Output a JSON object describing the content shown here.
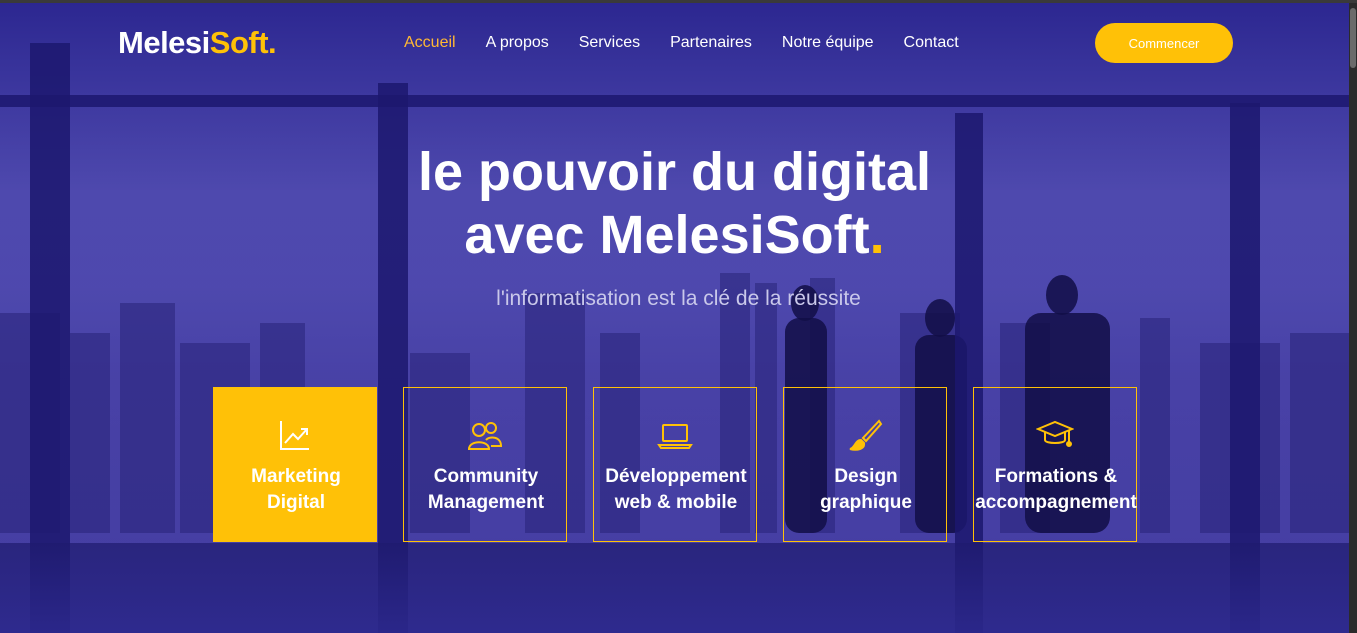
{
  "brand": {
    "name_main": "Melesi",
    "name_accent": "Soft",
    "dot": "."
  },
  "nav": {
    "items": [
      {
        "label": "Accueil",
        "active": true
      },
      {
        "label": "A propos",
        "active": false
      },
      {
        "label": "Services",
        "active": false
      },
      {
        "label": "Partenaires",
        "active": false
      },
      {
        "label": "Notre équipe",
        "active": false
      },
      {
        "label": "Contact",
        "active": false
      }
    ]
  },
  "cta": {
    "label": "Commencer"
  },
  "hero": {
    "line1": "le pouvoir du digital",
    "line2": "avec MelesiSoft",
    "dot": ".",
    "subtitle": "l'informatisation est la clé de la réussite"
  },
  "services": [
    {
      "line1": "Marketing",
      "line2": "Digital",
      "icon": "chart-line-icon",
      "highlighted": true
    },
    {
      "line1": "Community",
      "line2": "Management",
      "icon": "users-icon",
      "highlighted": false
    },
    {
      "line1": "Développement",
      "line2": "web & mobile",
      "icon": "laptop-icon",
      "highlighted": false
    },
    {
      "line1": "Design",
      "line2": "graphique",
      "icon": "paint-brush-icon",
      "highlighted": false
    },
    {
      "line1": "Formations &",
      "line2": "accompagnement",
      "icon": "graduation-cap-icon",
      "highlighted": false
    }
  ],
  "colors": {
    "accent": "#ffc107",
    "overlay": "#2a2a9a",
    "nav_active": "#ffb834"
  }
}
